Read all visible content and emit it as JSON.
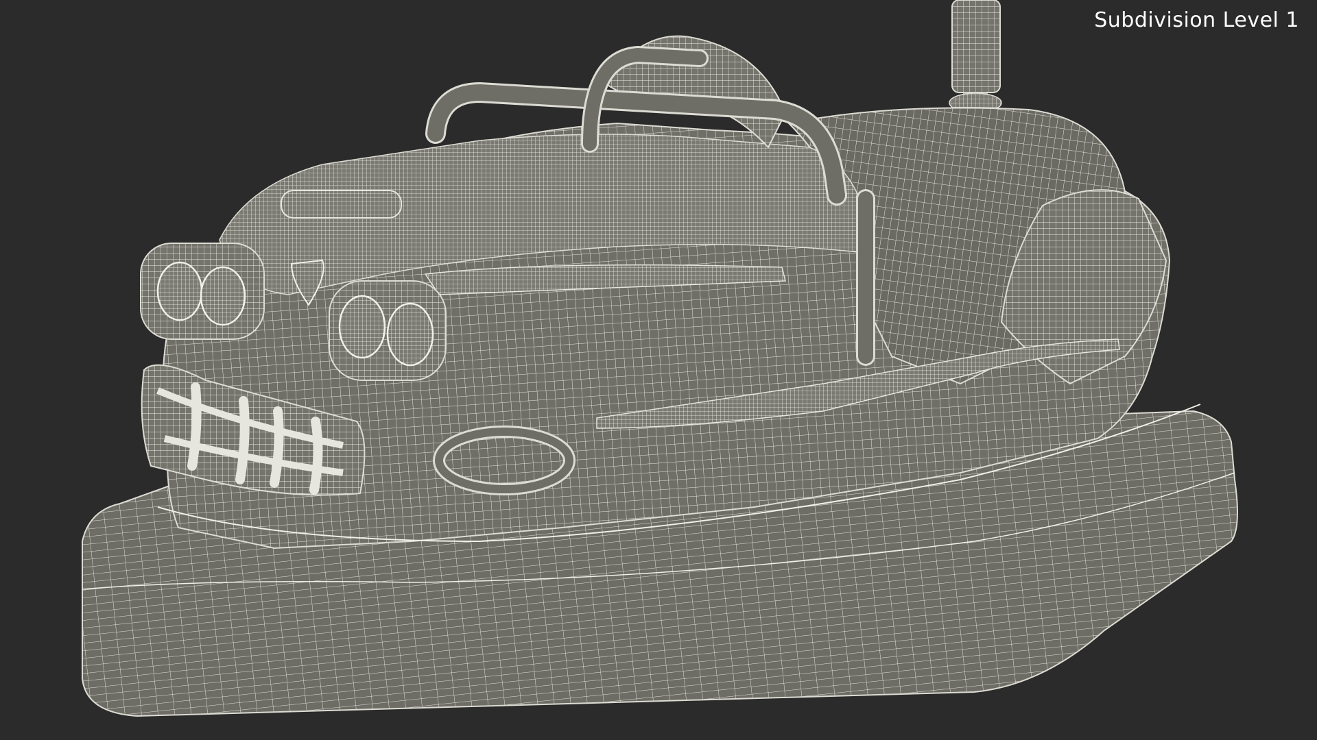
{
  "viewport": {
    "label": "Subdivision Level 1",
    "background_color": "#2b2b2b",
    "mesh_fill_color": "#6f6f68",
    "wire_color": "#e8e8e0"
  },
  "model": {
    "subject": "bumper car wireframe mesh"
  }
}
